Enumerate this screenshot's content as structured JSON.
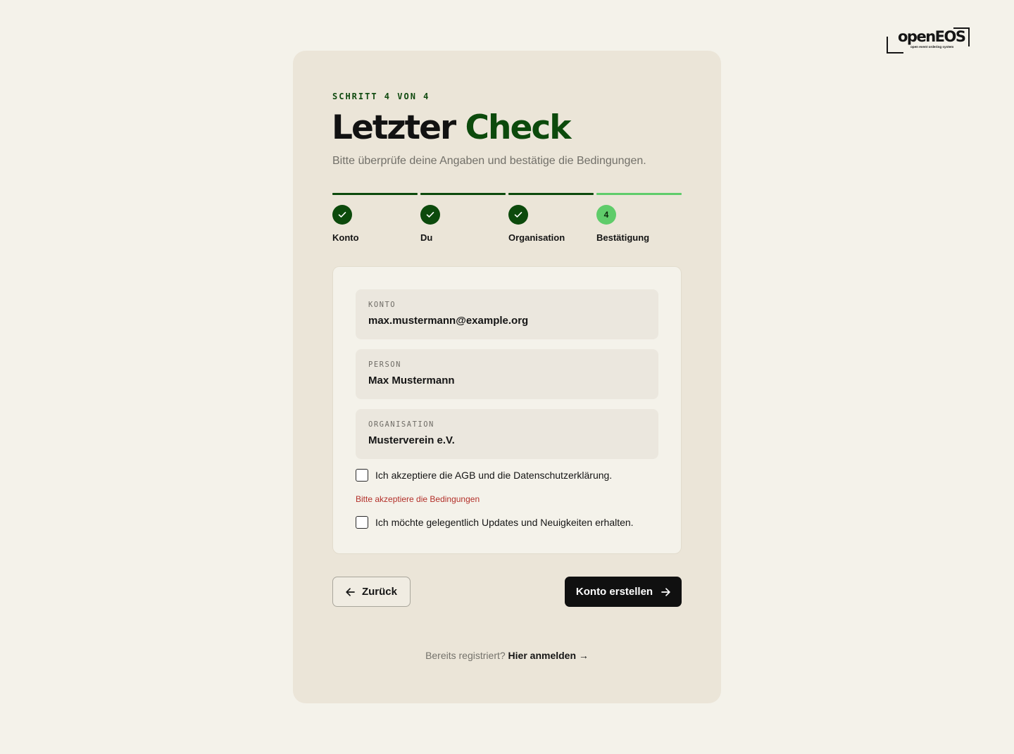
{
  "logo": {
    "name": "openEOS",
    "tagline": "open event ordering system"
  },
  "header": {
    "eyebrow": "SCHRITT 4 VON 4",
    "title_part1": "Letzter",
    "title_part2": "Check",
    "subtitle": "Bitte überprüfe deine Angaben und bestätige die Bedingungen."
  },
  "steps": [
    {
      "label": "Konto",
      "status": "done",
      "icon": "check-icon"
    },
    {
      "label": "Du",
      "status": "done",
      "icon": "check-icon"
    },
    {
      "label": "Organisation",
      "status": "done",
      "icon": "check-icon"
    },
    {
      "label": "Bestätigung",
      "status": "current",
      "number": "4"
    }
  ],
  "summary": {
    "account_label": "KONTO",
    "account_value": "max.mustermann@example.org",
    "person_label": "PERSON",
    "person_value": "Max Mustermann",
    "org_label": "ORGANISATION",
    "org_value": "Musterverein e.V."
  },
  "checkboxes": {
    "terms_label": "Ich akzeptiere die AGB und die Datenschutzerklärung.",
    "terms_checked": false,
    "terms_error": "Bitte akzeptiere die Bedingungen",
    "newsletter_label": "Ich möchte gelegentlich Updates und Neuigkeiten erhalten.",
    "newsletter_checked": false
  },
  "buttons": {
    "back_label": "Zurück",
    "submit_label": "Konto erstellen"
  },
  "footer": {
    "text": "Bereits registriert?",
    "link_label": "Hier anmelden →"
  },
  "colors": {
    "page_background": "#f4f2ea",
    "card_background": "#ebe5d8",
    "accent_dark_green": "#0c4a0c",
    "accent_light_green": "#5fcc6a",
    "error_red": "#b3302a",
    "primary_button": "#101010"
  }
}
